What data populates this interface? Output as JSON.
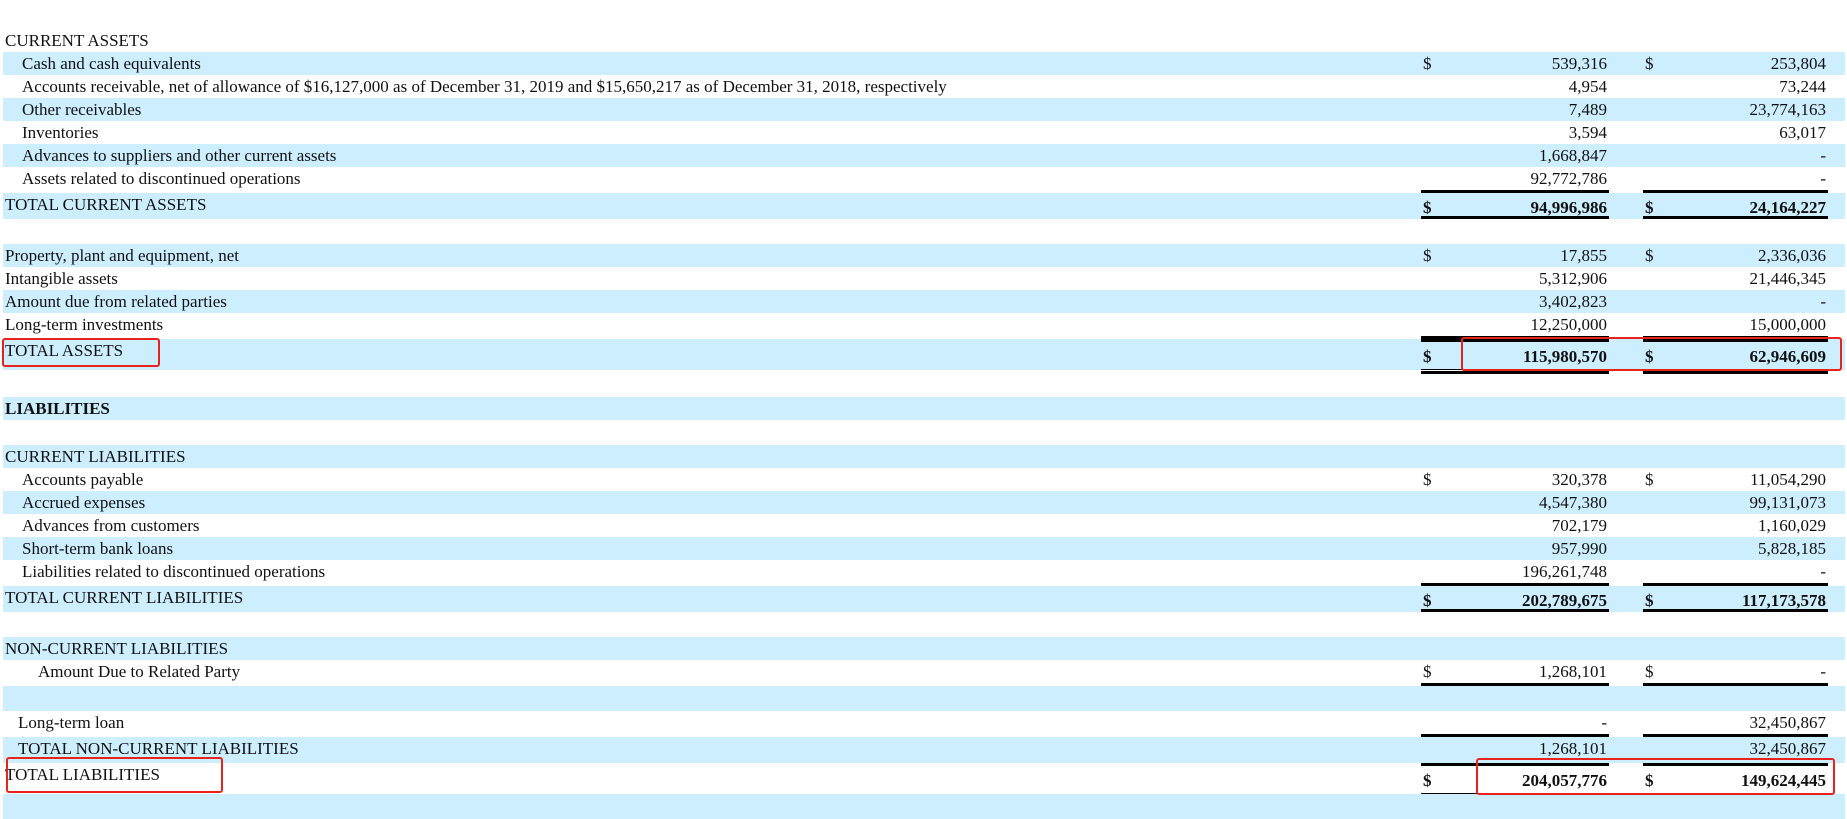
{
  "rows": [
    {
      "label": "CURRENT ASSETS",
      "indent": 0,
      "kind": "header",
      "stripe": false
    },
    {
      "label": "Cash and cash equivalents",
      "indent": 1,
      "kind": "item",
      "stripe": true,
      "c1_dollar": "$",
      "c1": "539,316",
      "c2_dollar": "$",
      "c2": "253,804"
    },
    {
      "label": "Accounts receivable, net of allowance of $16,127,000 as of December 31, 2019 and $15,650,217 as of December 31, 2018, respectively",
      "indent": 1,
      "kind": "item",
      "stripe": false,
      "c1": "4,954",
      "c2": "73,244"
    },
    {
      "label": "Other receivables",
      "indent": 1,
      "kind": "item",
      "stripe": true,
      "c1": "7,489",
      "c2": "23,774,163"
    },
    {
      "label": "Inventories",
      "indent": 1,
      "kind": "item",
      "stripe": false,
      "c1": "3,594",
      "c2": "63,017"
    },
    {
      "label": "Advances to suppliers and other current assets",
      "indent": 1,
      "kind": "item",
      "stripe": true,
      "c1": "1,668,847",
      "c2": "-"
    },
    {
      "label": "Assets related to discontinued operations",
      "indent": 1,
      "kind": "item-last",
      "stripe": false,
      "c1": "92,772,786",
      "c2": "-"
    },
    {
      "label": "TOTAL CURRENT ASSETS",
      "indent": 0,
      "kind": "subtotal",
      "stripe": true,
      "c1_dollar": "$",
      "c1": "94,996,986",
      "c2_dollar": "$",
      "c2": "24,164,227"
    },
    {
      "label": "",
      "kind": "blank",
      "stripe": false
    },
    {
      "label": "Property, plant and equipment, net",
      "indent": 0,
      "kind": "item",
      "stripe": true,
      "c1_dollar": "$",
      "c1": "17,855",
      "c2_dollar": "$",
      "c2": "2,336,036"
    },
    {
      "label": "Intangible assets",
      "indent": 0,
      "kind": "item",
      "stripe": false,
      "c1": "5,312,906",
      "c2": "21,446,345"
    },
    {
      "label": "Amount due from related parties",
      "indent": 0,
      "kind": "item",
      "stripe": true,
      "c1": "3,402,823",
      "c2": "-"
    },
    {
      "label": "Long-term investments",
      "indent": 0,
      "kind": "item-last",
      "stripe": false,
      "c1": "12,250,000",
      "c2": "15,000,000"
    },
    {
      "label": "TOTAL ASSETS",
      "indent": 0,
      "kind": "total",
      "stripe": true,
      "c1_dollar": "$",
      "c1": "115,980,570",
      "c2_dollar": "$",
      "c2": "62,946,609",
      "highlight": true
    },
    {
      "label": "",
      "kind": "blank-tall",
      "stripe": false
    },
    {
      "label": "LIABILITIES",
      "indent": 0,
      "kind": "section",
      "stripe": true
    },
    {
      "label": "",
      "kind": "blank",
      "stripe": false
    },
    {
      "label": "CURRENT LIABILITIES",
      "indent": 0,
      "kind": "header",
      "stripe": true
    },
    {
      "label": "Accounts payable",
      "indent": 1,
      "kind": "item",
      "stripe": false,
      "c1_dollar": "$",
      "c1": "320,378",
      "c2_dollar": "$",
      "c2": "11,054,290"
    },
    {
      "label": "Accrued expenses",
      "indent": 1,
      "kind": "item",
      "stripe": true,
      "c1": "4,547,380",
      "c2": "99,131,073"
    },
    {
      "label": "Advances from customers",
      "indent": 1,
      "kind": "item",
      "stripe": false,
      "c1": "702,179",
      "c2": "1,160,029"
    },
    {
      "label": "Short-term bank loans",
      "indent": 1,
      "kind": "item",
      "stripe": true,
      "c1": "957,990",
      "c2": "5,828,185"
    },
    {
      "label": "Liabilities related to discontinued operations",
      "indent": 1,
      "kind": "item-last",
      "stripe": false,
      "c1": "196,261,748",
      "c2": "-"
    },
    {
      "label": "TOTAL CURRENT LIABILITIES",
      "indent": 0,
      "kind": "subtotal",
      "stripe": true,
      "c1_dollar": "$",
      "c1": "202,789,675",
      "c2_dollar": "$",
      "c2": "117,173,578"
    },
    {
      "label": "",
      "kind": "blank",
      "stripe": false
    },
    {
      "label": "NON-CURRENT LIABILITIES",
      "indent": 0,
      "kind": "header",
      "stripe": true
    },
    {
      "label": "Amount Due to Related Party",
      "indent": 2,
      "kind": "item-last",
      "stripe": false,
      "c1_dollar": "$",
      "c1": "1,268,101",
      "c2_dollar": "$",
      "c2": "-"
    },
    {
      "label": "",
      "kind": "blank",
      "stripe": true
    },
    {
      "label": "Long-term loan",
      "indent": 3,
      "kind": "item-last",
      "stripe": false,
      "c1": "-",
      "c2": "32,450,867"
    },
    {
      "label": "TOTAL NON-CURRENT LIABILITIES",
      "indent": 3,
      "kind": "plain-total",
      "stripe": true,
      "c1": "1,268,101",
      "c2": "32,450,867"
    },
    {
      "label": "TOTAL LIABILITIES",
      "indent": 0,
      "kind": "total",
      "stripe": false,
      "c1_dollar": "$",
      "c1": "204,057,776",
      "c2_dollar": "$",
      "c2": "149,624,445",
      "highlight": true
    },
    {
      "label": "",
      "kind": "blank",
      "stripe": true
    }
  ],
  "highlight_color": "#e8231d",
  "stripe_color": "#cceeff"
}
